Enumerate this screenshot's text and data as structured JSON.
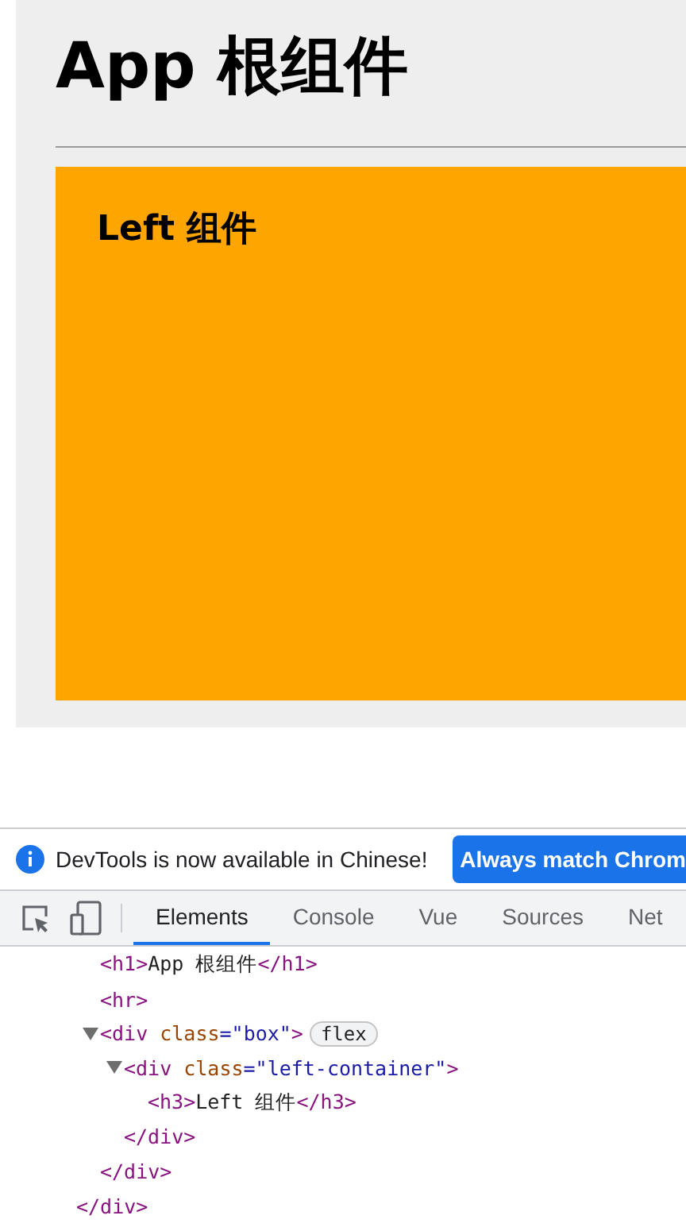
{
  "page": {
    "heading": "App 根组件",
    "left_panel": {
      "heading": "Left 组件"
    }
  },
  "devtools": {
    "banner": {
      "message": "DevTools is now available in Chinese!",
      "button": "Always match Chrom"
    },
    "tabs": [
      {
        "label": "Elements",
        "selected": true
      },
      {
        "label": "Console",
        "selected": false
      },
      {
        "label": "Vue",
        "selected": false
      },
      {
        "label": "Sources",
        "selected": false
      },
      {
        "label": "Net",
        "selected": false
      }
    ],
    "tree": {
      "children": [
        {
          "segments": [
            {
              "kind": "tag",
              "text": "<h1>"
            },
            {
              "kind": "text",
              "text": "App 根组件"
            },
            {
              "kind": "tag",
              "text": "</h1>"
            }
          ]
        },
        {
          "segments": [
            {
              "kind": "tag",
              "text": "<hr>"
            }
          ]
        },
        {
          "expanded": true,
          "segments": [
            {
              "kind": "tag",
              "text": "<div"
            },
            {
              "kind": "attr",
              "text": " class"
            },
            {
              "kind": "value",
              "text": "=\"box\""
            },
            {
              "kind": "tag",
              "text": ">"
            }
          ],
          "badge": "flex",
          "close": "</div>",
          "children": [
            {
              "expanded": true,
              "segments": [
                {
                  "kind": "tag",
                  "text": "<div"
                },
                {
                  "kind": "attr",
                  "text": " class"
                },
                {
                  "kind": "value",
                  "text": "=\"left-container\""
                },
                {
                  "kind": "tag",
                  "text": ">"
                }
              ],
              "close": "</div>",
              "children": [
                {
                  "segments": [
                    {
                      "kind": "tag",
                      "text": "<h3>"
                    },
                    {
                      "kind": "text",
                      "text": "Left 组件"
                    },
                    {
                      "kind": "tag",
                      "text": "</h3>"
                    }
                  ]
                }
              ]
            }
          ]
        }
      ],
      "close": "</div>"
    }
  }
}
